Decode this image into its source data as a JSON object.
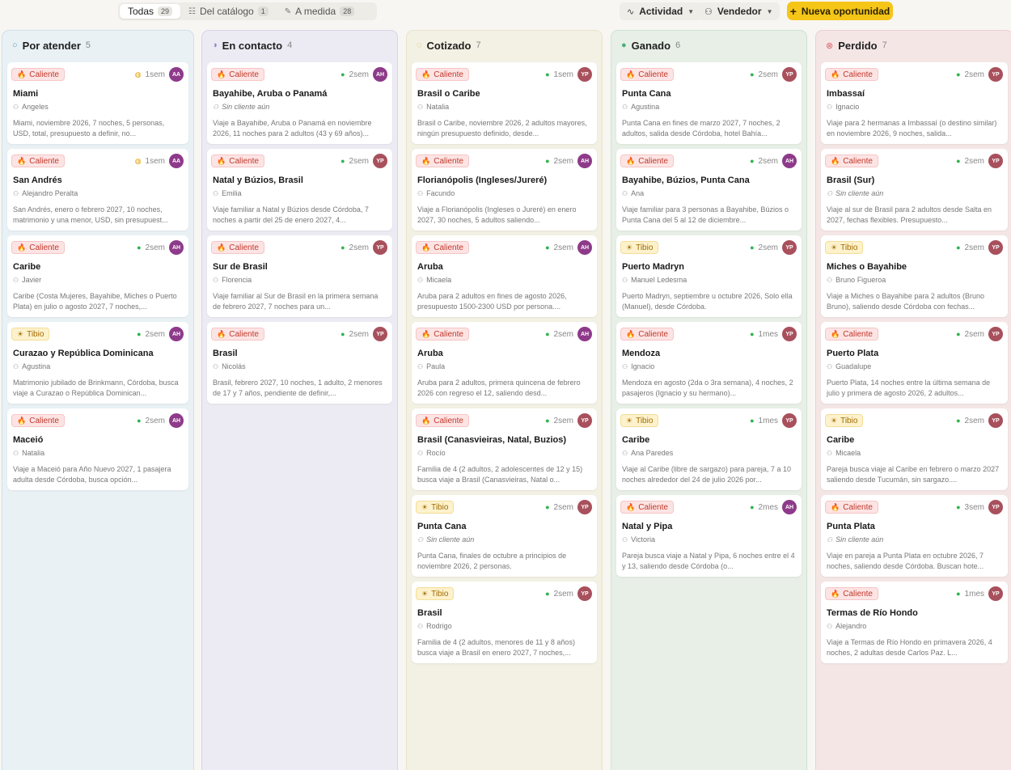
{
  "toolbar": {
    "filters": [
      {
        "label": "Todas",
        "count": "29",
        "icon": "",
        "active": true
      },
      {
        "label": "Del catálogo",
        "count": "1",
        "icon": "book-icon",
        "active": false
      },
      {
        "label": "A medida",
        "count": "28",
        "icon": "pencil-icon",
        "active": false
      }
    ],
    "activity_label": "Actividad",
    "seller_label": "Vendedor",
    "new_label": "Nueva oportunidad"
  },
  "columns": [
    {
      "title": "Por atender",
      "count": "5",
      "bg": "#e9f1f5",
      "border": "#cfe0ea",
      "dot": "#6d99b6",
      "dot_style": "ring",
      "cards": [
        {
          "temp": "Caliente",
          "temp_type": "hot",
          "channel": "web",
          "age": "1sem",
          "seller": "AA",
          "title": "Miami",
          "client": "Angeles",
          "desc": "Miami, noviembre 2026, 7 noches, 5 personas, USD, total, presupuesto a definir, no..."
        },
        {
          "temp": "Caliente",
          "temp_type": "hot",
          "channel": "web",
          "age": "1sem",
          "seller": "AA",
          "title": "San Andrés",
          "client": "Alejandro Peralta",
          "desc": "San Andrés, enero o febrero 2027, 10 noches, matrimonio y una menor, USD, sin presupuest..."
        },
        {
          "temp": "Caliente",
          "temp_type": "hot",
          "channel": "whatsapp",
          "age": "2sem",
          "seller": "AH",
          "title": "Caribe",
          "client": "Javier",
          "desc": "Caribe (Costa Mujeres, Bayahibe, Miches o Puerto Plata) en julio o agosto 2027, 7 noches,..."
        },
        {
          "temp": "Tibio",
          "temp_type": "warm",
          "channel": "whatsapp",
          "age": "2sem",
          "seller": "AH",
          "title": "Curazao y República Dominicana",
          "client": "Agustina",
          "desc": "Matrimonio jubilado de Brinkmann, Córdoba, busca viaje a Curazao o República Dominican..."
        },
        {
          "temp": "Caliente",
          "temp_type": "hot",
          "channel": "whatsapp",
          "age": "2sem",
          "seller": "AH",
          "title": "Maceió",
          "client": "Natalia",
          "desc": "Viaje a Maceió para Año Nuevo 2027, 1 pasajera adulta desde Córdoba, busca opción..."
        }
      ]
    },
    {
      "title": "En contacto",
      "count": "4",
      "bg": "#ecebf3",
      "border": "#d8d4ea",
      "dot": "#8c7bc4",
      "dot_style": "half",
      "cards": [
        {
          "temp": "Caliente",
          "temp_type": "hot",
          "channel": "whatsapp",
          "age": "2sem",
          "seller": "AH",
          "title": "Bayahibe, Aruba o Panamá",
          "client": "Sin cliente aún",
          "no_client": true,
          "desc": "Viaje a Bayahibe, Aruba o Panamá en noviembre 2026, 11 noches para 2 adultos (43 y 69 años)..."
        },
        {
          "temp": "Caliente",
          "temp_type": "hot",
          "channel": "whatsapp",
          "age": "2sem",
          "seller": "YP",
          "title": "Natal y Búzios, Brasil",
          "client": "Emilia",
          "desc": "Viaje familiar a Natal y Búzios desde Córdoba, 7 noches a partir del 25 de enero 2027, 4..."
        },
        {
          "temp": "Caliente",
          "temp_type": "hot",
          "channel": "whatsapp",
          "age": "2sem",
          "seller": "YP",
          "title": "Sur de Brasil",
          "client": "Florencia",
          "desc": "Viaje familiar al Sur de Brasil en la primera semana de febrero 2027, 7 noches para un..."
        },
        {
          "temp": "Caliente",
          "temp_type": "hot",
          "channel": "whatsapp",
          "age": "2sem",
          "seller": "YP",
          "title": "Brasil",
          "client": "Nicolás",
          "desc": "Brasil, febrero 2027, 10 noches, 1 adulto, 2 menores de 17 y 7 años, pendiente de definir,..."
        }
      ]
    },
    {
      "title": "Cotizado",
      "count": "7",
      "bg": "#f3f0e4",
      "border": "#ebe3c8",
      "dot": "#d8b24a",
      "dot_style": "dashed",
      "cards": [
        {
          "temp": "Caliente",
          "temp_type": "hot",
          "channel": "whatsapp",
          "age": "1sem",
          "seller": "YP",
          "title": "Brasil o Caribe",
          "client": "Natalia",
          "desc": "Brasil o Caribe, noviembre 2026, 2 adultos mayores, ningún presupuesto definido, desde..."
        },
        {
          "temp": "Caliente",
          "temp_type": "hot",
          "channel": "whatsapp",
          "age": "2sem",
          "seller": "AH",
          "title": "Florianópolis (Ingleses/Jureré)",
          "client": "Facundo",
          "desc": "Viaje a Florianópolis (Ingleses o Jureré) en enero 2027, 30 noches, 5 adultos saliendo..."
        },
        {
          "temp": "Caliente",
          "temp_type": "hot",
          "channel": "whatsapp",
          "age": "2sem",
          "seller": "AH",
          "title": "Aruba",
          "client": "Micaela",
          "desc": "Aruba para 2 adultos en fines de agosto 2026, presupuesto 1500-2300 USD por persona...."
        },
        {
          "temp": "Caliente",
          "temp_type": "hot",
          "channel": "whatsapp",
          "age": "2sem",
          "seller": "AH",
          "title": "Aruba",
          "client": "Paula",
          "desc": "Aruba para 2 adultos, primera quincena de febrero 2026 con regreso el 12, saliendo desd..."
        },
        {
          "temp": "Caliente",
          "temp_type": "hot",
          "channel": "whatsapp",
          "age": "2sem",
          "seller": "YP",
          "title": "Brasil (Canasvieiras, Natal, Buzios)",
          "client": "Rocío",
          "desc": "Familia de 4 (2 adultos, 2 adolescentes de 12 y 15) busca viaje a Brasil (Canasvieiras, Natal o..."
        },
        {
          "temp": "Tibio",
          "temp_type": "warm",
          "channel": "whatsapp",
          "age": "2sem",
          "seller": "YP",
          "title": "Punta Cana",
          "client": "Sin cliente aún",
          "no_client": true,
          "desc": "Punta Cana, finales de octubre a principios de noviembre 2026, 2 personas."
        },
        {
          "temp": "Tibio",
          "temp_type": "warm",
          "channel": "whatsapp",
          "age": "2sem",
          "seller": "YP",
          "title": "Brasil",
          "client": "Rodrigo",
          "desc": "Familia de 4 (2 adultos, menores de 11 y 8 años) busca viaje a Brasil en enero 2027, 7 noches,..."
        }
      ]
    },
    {
      "title": "Ganado",
      "count": "6",
      "bg": "#e7efe7",
      "border": "#cfe3d2",
      "dot": "#4caf78",
      "dot_style": "check",
      "cards": [
        {
          "temp": "Caliente",
          "temp_type": "hot",
          "channel": "whatsapp",
          "age": "2sem",
          "seller": "YP",
          "title": "Punta Cana",
          "client": "Agustina",
          "desc": "Punta Cana en fines de marzo 2027, 7 noches, 2 adultos, salida desde Córdoba, hotel Bahía..."
        },
        {
          "temp": "Caliente",
          "temp_type": "hot",
          "channel": "whatsapp",
          "age": "2sem",
          "seller": "AH",
          "title": "Bayahibe, Búzios, Punta Cana",
          "client": "Ana",
          "desc": "Viaje familiar para 3 personas a Bayahibe, Búzios o Punta Cana del 5 al 12 de diciembre..."
        },
        {
          "temp": "Tibio",
          "temp_type": "warm",
          "channel": "whatsapp",
          "age": "2sem",
          "seller": "YP",
          "title": "Puerto Madryn",
          "client": "Manuel Ledesma",
          "desc": "Puerto Madryn, septiembre u octubre 2026, Solo ella (Manuel), desde Córdoba."
        },
        {
          "temp": "Caliente",
          "temp_type": "hot",
          "channel": "whatsapp",
          "age": "1mes",
          "seller": "YP",
          "title": "Mendoza",
          "client": "Ignacio",
          "desc": "Mendoza en agosto (2da o 3ra semana), 4 noches, 2 pasajeros (Ignacio y su hermano)..."
        },
        {
          "temp": "Tibio",
          "temp_type": "warm",
          "channel": "whatsapp",
          "age": "1mes",
          "seller": "YP",
          "title": "Caribe",
          "client": "Ana Paredes",
          "desc": "Viaje al Caribe (libre de sargazo) para pareja, 7 a 10 noches alrededor del 24 de julio 2026 por..."
        },
        {
          "temp": "Caliente",
          "temp_type": "hot",
          "channel": "whatsapp",
          "age": "2mes",
          "seller": "AH",
          "title": "Natal y Pipa",
          "client": "Victoria",
          "desc": "Pareja busca viaje a Natal y Pipa, 6 noches entre el 4 y 13, saliendo desde Córdoba (o..."
        }
      ]
    },
    {
      "title": "Perdido",
      "count": "7",
      "bg": "#f5e6e6",
      "border": "#ecd0d0",
      "dot": "#d9646a",
      "dot_style": "x",
      "cards": [
        {
          "temp": "Caliente",
          "temp_type": "hot",
          "channel": "whatsapp",
          "age": "2sem",
          "seller": "YP",
          "title": "Imbassaí",
          "client": "Ignacio",
          "desc": "Viaje para 2 hermanas a Imbassaí (o destino similar) en noviembre 2026, 9 noches, salida..."
        },
        {
          "temp": "Caliente",
          "temp_type": "hot",
          "channel": "whatsapp",
          "age": "2sem",
          "seller": "YP",
          "title": "Brasil (Sur)",
          "client": "Sin cliente aún",
          "no_client": true,
          "desc": "Viaje al sur de Brasil para 2 adultos desde Salta en 2027, fechas flexibles. Presupuesto..."
        },
        {
          "temp": "Tibio",
          "temp_type": "warm",
          "channel": "whatsapp",
          "age": "2sem",
          "seller": "YP",
          "title": "Miches o Bayahibe",
          "client": "Bruno Figueroa",
          "desc": "Viaje a Miches o Bayahibe para 2 adultos (Bruno Bruno), saliendo desde Córdoba con fechas..."
        },
        {
          "temp": "Caliente",
          "temp_type": "hot",
          "channel": "whatsapp",
          "age": "2sem",
          "seller": "YP",
          "title": "Puerto Plata",
          "client": "Guadalupe",
          "desc": "Puerto Plata, 14 noches entre la última semana de julio y primera de agosto 2026, 2 adultos..."
        },
        {
          "temp": "Tibio",
          "temp_type": "warm",
          "channel": "whatsapp",
          "age": "2sem",
          "seller": "YP",
          "title": "Caribe",
          "client": "Micaela",
          "desc": "Pareja busca viaje al Caribe en febrero o marzo 2027 saliendo desde Tucumán, sin sargazo...."
        },
        {
          "temp": "Caliente",
          "temp_type": "hot",
          "channel": "whatsapp",
          "age": "3sem",
          "seller": "YP",
          "title": "Punta Plata",
          "client": "Sin cliente aún",
          "no_client": true,
          "desc": "Viaje en pareja a Punta Plata en octubre 2026, 7 noches, saliendo desde Córdoba. Buscan hote..."
        },
        {
          "temp": "Caliente",
          "temp_type": "hot",
          "channel": "whatsapp",
          "age": "1mes",
          "seller": "YP",
          "title": "Termas de Río Hondo",
          "client": "Alejandro",
          "desc": "Viaje a Termas de Río Hondo en primavera 2026, 4 noches, 2 adultas desde Carlos Paz. L..."
        }
      ]
    }
  ]
}
